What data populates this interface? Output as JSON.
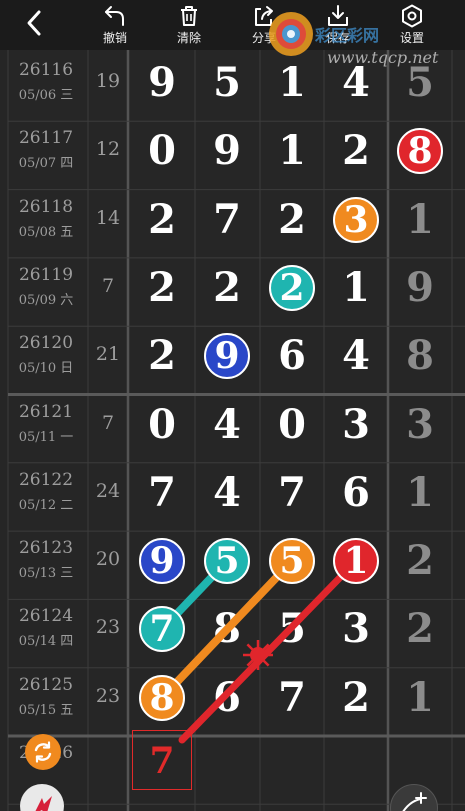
{
  "toolbar": {
    "undo_label": "撤销",
    "clear_label": "清除",
    "share_label": "分享",
    "save_label": "保存",
    "settings_label": "设置"
  },
  "watermark": {
    "title": "彩区彩网",
    "url": "www.tqcp.net"
  },
  "rows": [
    {
      "id": "26116",
      "date": "05/06 三",
      "sum": "19",
      "digits": [
        "9",
        "5",
        "1",
        "4"
      ],
      "last": "5"
    },
    {
      "id": "26117",
      "date": "05/07 四",
      "sum": "12",
      "digits": [
        "0",
        "9",
        "1",
        "2"
      ],
      "last": "8"
    },
    {
      "id": "26118",
      "date": "05/08 五",
      "sum": "14",
      "digits": [
        "2",
        "7",
        "2",
        "3"
      ],
      "last": "1"
    },
    {
      "id": "26119",
      "date": "05/09 六",
      "sum": "7",
      "digits": [
        "2",
        "2",
        "2",
        "1"
      ],
      "last": "9"
    },
    {
      "id": "26120",
      "date": "05/10 日",
      "sum": "21",
      "digits": [
        "2",
        "9",
        "6",
        "4"
      ],
      "last": "8"
    },
    {
      "id": "26121",
      "date": "05/11 一",
      "sum": "7",
      "digits": [
        "0",
        "4",
        "0",
        "3"
      ],
      "last": "3"
    },
    {
      "id": "26122",
      "date": "05/12 二",
      "sum": "24",
      "digits": [
        "7",
        "4",
        "7",
        "6"
      ],
      "last": "1"
    },
    {
      "id": "26123",
      "date": "05/13 三",
      "sum": "20",
      "digits": [
        "9",
        "5",
        "5",
        "1"
      ],
      "last": "2"
    },
    {
      "id": "26124",
      "date": "05/14 四",
      "sum": "23",
      "digits": [
        "7",
        "8",
        "5",
        "3"
      ],
      "last": "2"
    },
    {
      "id": "26125",
      "date": "05/15 五",
      "sum": "23",
      "digits": [
        "8",
        "6",
        "7",
        "2"
      ],
      "last": "1"
    },
    {
      "id": "26126",
      "date": "",
      "sum": "",
      "digits": [
        "",
        "",
        "",
        ""
      ],
      "last": ""
    }
  ],
  "highlights": [
    {
      "row": 1,
      "col": 4,
      "value": "8",
      "color": "#e0262c"
    },
    {
      "row": 2,
      "col": 3,
      "value": "3",
      "color": "#f08a1f"
    },
    {
      "row": 3,
      "col": 2,
      "value": "2",
      "color": "#1fb5b0"
    },
    {
      "row": 4,
      "col": 1,
      "value": "9",
      "color": "#2a47c8"
    },
    {
      "row": 7,
      "col": 0,
      "value": "9",
      "color": "#2a47c8"
    },
    {
      "row": 7,
      "col": 1,
      "value": "5",
      "color": "#1fb5b0"
    },
    {
      "row": 7,
      "col": 2,
      "value": "5",
      "color": "#f08a1f"
    },
    {
      "row": 7,
      "col": 3,
      "value": "1",
      "color": "#e0262c"
    },
    {
      "row": 8,
      "col": 0,
      "value": "7",
      "color": "#1fb5b0"
    },
    {
      "row": 9,
      "col": 0,
      "value": "8",
      "color": "#f08a1f"
    }
  ],
  "cursor_value": "7",
  "colors": {
    "red": "#e0262c",
    "orange": "#f08a1f",
    "teal": "#1fb5b0",
    "blue": "#2a47c8",
    "background": "#262626"
  }
}
